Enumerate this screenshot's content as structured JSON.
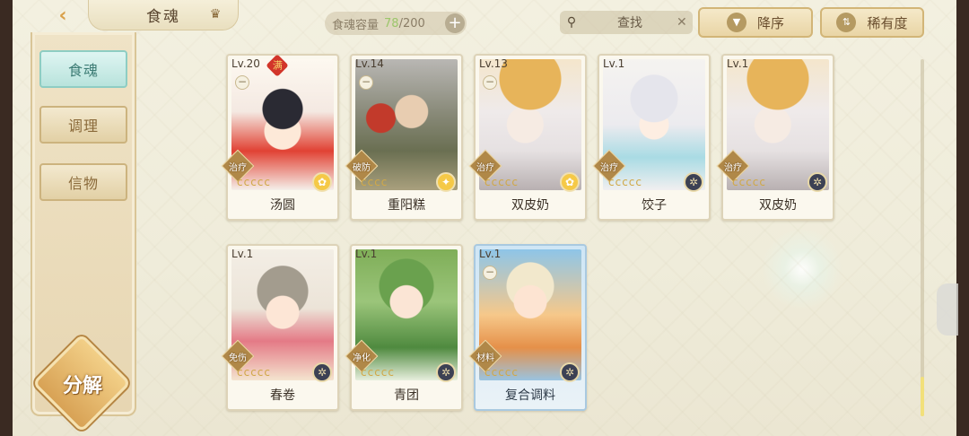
{
  "header": {
    "title": "食魂",
    "capacity_label": "食魂容量",
    "capacity_current": "78",
    "capacity_total": "/200",
    "search_label": "查找",
    "sort_order": "降序",
    "sort_by": "稀有度",
    "back_icon": "back-arrow-icon",
    "crown_icon": "crown-icon"
  },
  "sidebar": {
    "items": [
      {
        "label": "食魂",
        "active": true
      },
      {
        "label": "调理",
        "active": false
      },
      {
        "label": "信物",
        "active": false
      }
    ],
    "decompose_label": "分解"
  },
  "cards": [
    {
      "level": "Lv.20",
      "full": "满",
      "role": "治疗",
      "stars": "ccccc",
      "element": "gold",
      "name": "汤圆"
    },
    {
      "level": "Lv.14",
      "full": "",
      "role": "破防",
      "stars": "cccc",
      "element": "gold",
      "name": "重阳糕"
    },
    {
      "level": "Lv.13",
      "full": "",
      "role": "治疗",
      "stars": "ccccc",
      "element": "gold",
      "name": "双皮奶"
    },
    {
      "level": "Lv.1",
      "full": "",
      "role": "治疗",
      "stars": "ccccc",
      "element": "dark",
      "name": "饺子"
    },
    {
      "level": "Lv.1",
      "full": "",
      "role": "治疗",
      "stars": "ccccc",
      "element": "dark",
      "name": "双皮奶"
    },
    {
      "level": "Lv.1",
      "full": "",
      "role": "免伤",
      "stars": "ccccc",
      "element": "dark",
      "name": "春卷"
    },
    {
      "level": "Lv.1",
      "full": "",
      "role": "净化",
      "stars": "ccccc",
      "element": "dark",
      "name": "青团"
    },
    {
      "level": "Lv.1",
      "full": "",
      "role": "材料",
      "stars": "ccccc",
      "element": "dark",
      "name": "复合调料"
    }
  ]
}
